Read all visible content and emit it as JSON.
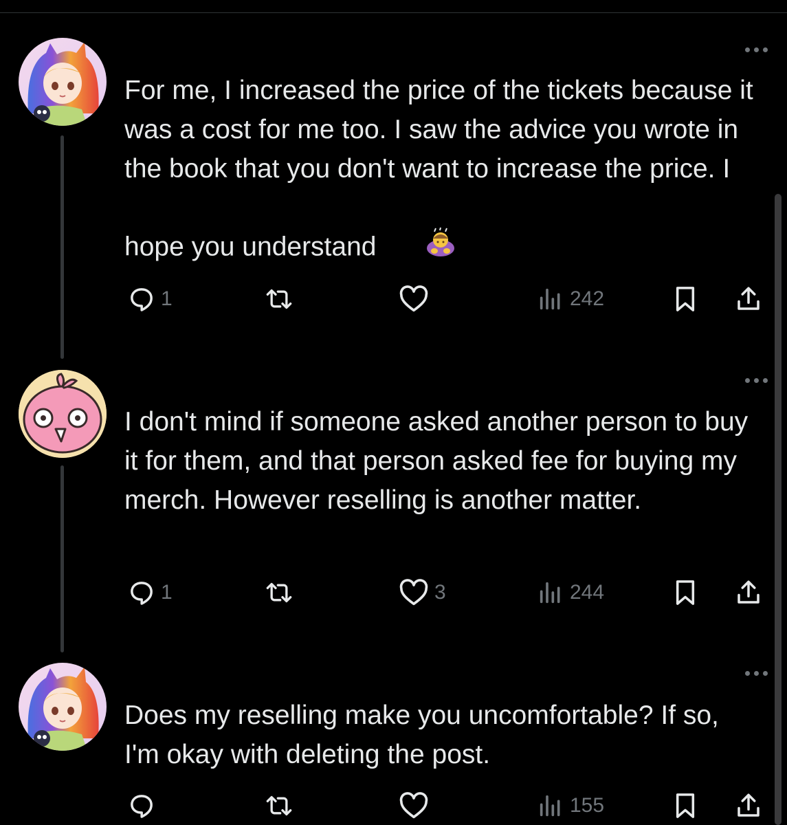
{
  "tweets": [
    {
      "text": "For me, I increased the price of the tickets because it was a cost for me too. I saw the advice you wrote in the book that you don't want to increase the price. I hope you understand",
      "emoji": "bowing-person",
      "counts": {
        "reply": "1",
        "retweet": "",
        "like": "",
        "views": "242"
      }
    },
    {
      "text": "I don't mind if someone asked another person to buy it for them, and that person asked fee for buying my merch. However reselling is another matter.",
      "counts": {
        "reply": "1",
        "retweet": "",
        "like": "3",
        "views": "244"
      }
    },
    {
      "text": "Does my reselling make you uncomfortable? If so, I'm okay with deleting the post.",
      "counts": {
        "reply": "",
        "retweet": "",
        "like": "",
        "views": "155"
      }
    }
  ],
  "colors": {
    "background": "#000000",
    "text": "#e7e9ea",
    "muted": "#71767b",
    "line": "#333639"
  }
}
